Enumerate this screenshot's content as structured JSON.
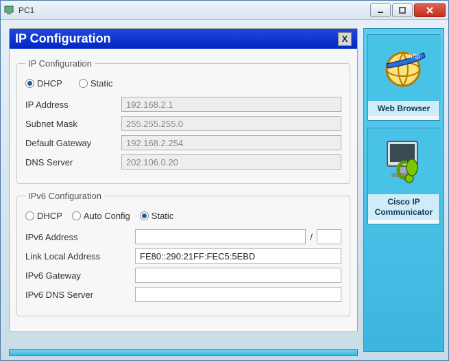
{
  "window": {
    "title": "PC1"
  },
  "dialog": {
    "title": "IP Configuration",
    "close": "X"
  },
  "ipv4": {
    "legend": "IP Configuration",
    "mode_dhcp": "DHCP",
    "mode_static": "Static",
    "ip_label": "IP Address",
    "ip_value": "192.168.2.1",
    "mask_label": "Subnet Mask",
    "mask_value": "255.255.255.0",
    "gw_label": "Default Gateway",
    "gw_value": "192.168.2.254",
    "dns_label": "DNS Server",
    "dns_value": "202.106.0.20"
  },
  "ipv6": {
    "legend": "IPv6 Configuration",
    "mode_dhcp": "DHCP",
    "mode_auto": "Auto Config",
    "mode_static": "Static",
    "addr_label": "IPv6 Address",
    "addr_value": "",
    "prefix_value": "",
    "lla_label": "Link Local Address",
    "lla_value": "FE80::290:21FF:FEC5:5EBD",
    "gw_label": "IPv6 Gateway",
    "gw_value": "",
    "dns_label": "IPv6 DNS Server",
    "dns_value": ""
  },
  "sidebar": {
    "web_browser": "Web Browser",
    "cisco_ip": "Cisco IP Communicator"
  }
}
